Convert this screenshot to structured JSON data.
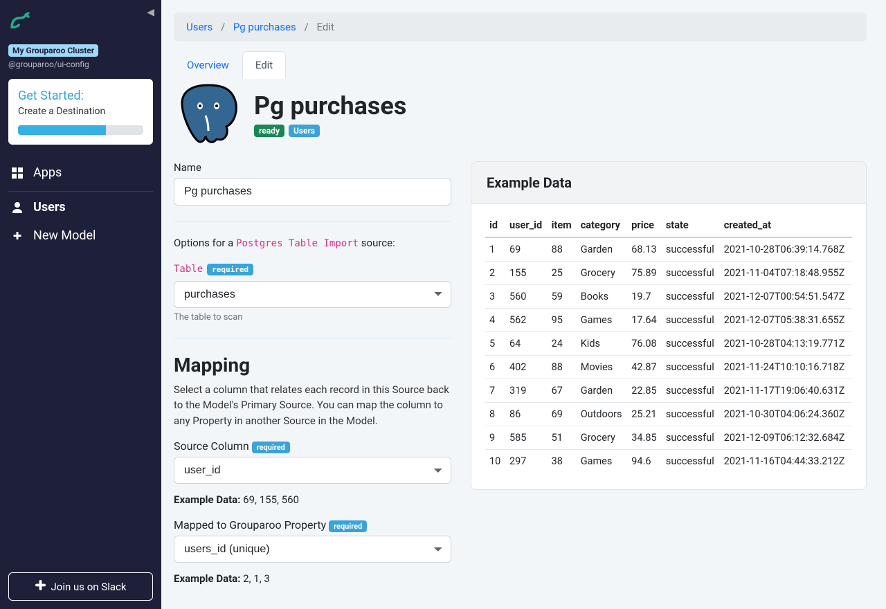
{
  "sidebar": {
    "cluster_badge": "My Grouparoo Cluster",
    "cluster_sub": "@grouparoo/ui-config",
    "get_started": {
      "title": "Get Started:",
      "subtitle": "Create a Destination",
      "progress_percent": 70
    },
    "nav": [
      {
        "label": "Apps",
        "icon": "grid-icon",
        "active": false
      },
      {
        "label": "Users",
        "icon": "user-icon",
        "active": true
      },
      {
        "label": "New Model",
        "icon": "plus-icon",
        "active": false
      }
    ],
    "slack_button": "Join us on Slack"
  },
  "breadcrumb": {
    "items": [
      "Users",
      "Pg purchases"
    ],
    "current": "Edit"
  },
  "tabs": [
    {
      "label": "Overview",
      "active": false
    },
    {
      "label": "Edit",
      "active": true
    }
  ],
  "header": {
    "title": "Pg purchases",
    "badges": [
      {
        "text": "ready",
        "class": "ready"
      },
      {
        "text": "Users",
        "class": "users"
      }
    ]
  },
  "form": {
    "name_label": "Name",
    "name_value": "Pg purchases",
    "options_prefix": "Options for a ",
    "options_code": "Postgres Table Import",
    "options_suffix": " source:",
    "table_label": "Table",
    "table_required": "required",
    "table_value": "purchases",
    "table_help": "The table to scan",
    "mapping_title": "Mapping",
    "mapping_desc": "Select a column that relates each record in this Source back to the Model's Primary Source. You can map the column to any Property in another Source in the Model.",
    "source_column_label": "Source Column",
    "source_column_required": "required",
    "source_column_value": "user_id",
    "source_example_label": "Example Data:",
    "source_example_values": "69, 155, 560",
    "mapped_label": "Mapped to Grouparoo Property",
    "mapped_required": "required",
    "mapped_value": "users_id (unique)",
    "mapped_example_label": "Example Data:",
    "mapped_example_values": "2, 1, 3"
  },
  "example_data": {
    "title": "Example Data",
    "columns": [
      "id",
      "user_id",
      "item",
      "category",
      "price",
      "state",
      "created_at"
    ],
    "rows": [
      [
        "1",
        "69",
        "88",
        "Garden",
        "68.13",
        "successful",
        "2021-10-28T06:39:14.768Z"
      ],
      [
        "2",
        "155",
        "25",
        "Grocery",
        "75.89",
        "successful",
        "2021-11-04T07:18:48.955Z"
      ],
      [
        "3",
        "560",
        "59",
        "Books",
        "19.7",
        "successful",
        "2021-12-07T00:54:51.547Z"
      ],
      [
        "4",
        "562",
        "95",
        "Games",
        "17.64",
        "successful",
        "2021-12-07T05:38:31.655Z"
      ],
      [
        "5",
        "64",
        "24",
        "Kids",
        "76.08",
        "successful",
        "2021-10-28T04:13:19.771Z"
      ],
      [
        "6",
        "402",
        "88",
        "Movies",
        "42.87",
        "successful",
        "2021-11-24T10:10:16.718Z"
      ],
      [
        "7",
        "319",
        "67",
        "Garden",
        "22.85",
        "successful",
        "2021-11-17T19:06:40.631Z"
      ],
      [
        "8",
        "86",
        "69",
        "Outdoors",
        "25.21",
        "successful",
        "2021-10-30T04:06:24.360Z"
      ],
      [
        "9",
        "585",
        "51",
        "Grocery",
        "34.85",
        "successful",
        "2021-12-09T06:12:32.684Z"
      ],
      [
        "10",
        "297",
        "38",
        "Games",
        "94.6",
        "successful",
        "2021-11-16T04:44:33.212Z"
      ]
    ]
  }
}
